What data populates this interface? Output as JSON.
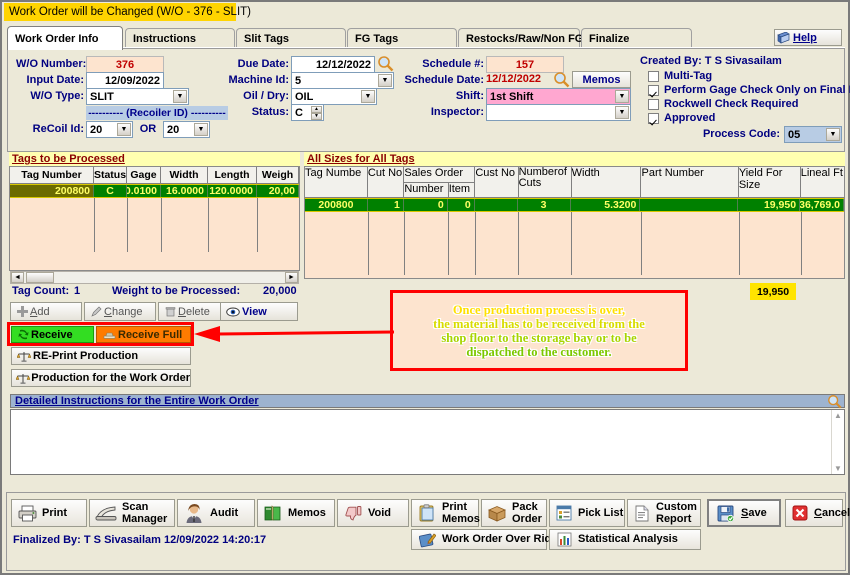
{
  "window": {
    "title": "Work Order will be Changed  (W/O - 376 - SLIT)"
  },
  "tabs": [
    {
      "label": "Work Order Info",
      "active": true
    },
    {
      "label": "Instructions",
      "active": false
    },
    {
      "label": "Slit Tags",
      "active": false
    },
    {
      "label": "FG Tags",
      "active": false
    },
    {
      "label": "Restocks/Raw/Non FG",
      "active": false
    },
    {
      "label": "Finalize",
      "active": false
    }
  ],
  "help_button": "Help",
  "form": {
    "wo_number_label": "W/O Number:",
    "wo_number_value": "376",
    "input_date_label": "Input Date:",
    "input_date_value": "12/09/2022",
    "wo_type_label": "W/O Type:",
    "wo_type_value": "SLIT",
    "recoiler_bar": "---------- (Recoiler ID)  ----------",
    "recoil_id_label": "ReCoil Id:",
    "recoil_id_value": "20",
    "or_label": "OR",
    "recoil_id2_value": "20",
    "due_date_label": "Due Date:",
    "due_date_value": "12/12/2022",
    "machine_id_label": "Machine Id:",
    "machine_id_value": "5",
    "oil_dry_label": "Oil / Dry:",
    "oil_dry_value": "OIL",
    "status_label": "Status:",
    "status_value": "C",
    "schedule_num_label": "Schedule #:",
    "schedule_num_value": "157",
    "schedule_date_label": "Schedule Date:",
    "schedule_date_value": "12/12/2022",
    "memos_button": "Memos",
    "shift_label": "Shift:",
    "shift_value": "1st Shift",
    "inspector_label": "Inspector:",
    "inspector_value": "",
    "created_by": "Created By: T S Sivasailam",
    "checkboxes": [
      {
        "label": "Multi-Tag",
        "checked": false
      },
      {
        "label": "Perform Gage Check Only on Final Break",
        "checked": true
      },
      {
        "label": "Rockwell Check Required",
        "checked": false
      },
      {
        "label": "Approved",
        "checked": true
      }
    ],
    "process_code_label": "Process Code:",
    "process_code_value": "05"
  },
  "left_grid": {
    "title": "Tags to be Processed",
    "columns": [
      "Tag Number",
      "Status",
      "Gage",
      "Width",
      "Length",
      "Weigh"
    ],
    "rows": [
      [
        "200800",
        "C",
        "0.0100",
        "16.0000",
        "120.0000",
        "20,00"
      ]
    ],
    "tag_count_label": "Tag Count:",
    "tag_count_value": "1",
    "weight_label": "Weight to be Processed:",
    "weight_value": "20,000"
  },
  "right_grid": {
    "title": "All Sizes for All Tags",
    "columns": [
      "Tag Numbe",
      "Cut No",
      "Sales Order",
      "Number",
      "Item",
      "Cust No",
      "Number of Cuts",
      "Width",
      "Part Number",
      "Yield For Size",
      "Lineal Ft"
    ],
    "group_header": "Sales Order",
    "sub_headers": [
      "Number",
      "Item"
    ],
    "rows": [
      {
        "tag_number": "200800",
        "cut_no": "1",
        "so_number": "0",
        "so_item": "0",
        "cust_no": "",
        "number_of_cuts": "3",
        "width": "5.3200",
        "part_number": "",
        "yield_for_size": "19,950",
        "lineal_ft": "36,769.0"
      }
    ],
    "total_yield": "19,950"
  },
  "action_buttons": [
    {
      "label": "Add",
      "icon": "plus-icon"
    },
    {
      "label": "Change",
      "icon": "pencil-icon"
    },
    {
      "label": "Delete",
      "icon": "trash-icon"
    },
    {
      "label": "View",
      "icon": "eye-icon"
    }
  ],
  "receive_buttons": [
    {
      "label": "Receive",
      "icon": "receive-icon",
      "color": "#33dd22"
    },
    {
      "label": "Receive Full",
      "icon": "receive-full-icon",
      "color": "#ff7b00"
    }
  ],
  "production_buttons": [
    {
      "label": "RE-Print Production",
      "icon": "scales-icon"
    },
    {
      "label": "Production for the Work Order",
      "icon": "scales-icon"
    }
  ],
  "annotation": {
    "lines": [
      "Once production process is over,",
      "the material has to be received from the",
      "shop floor to the storage bay or to be",
      "dispatched to the customer."
    ],
    "border_color": "#ff0000"
  },
  "instructions": {
    "header": "Detailed Instructions for the Entire Work Order",
    "body": ""
  },
  "toolbar_row1": [
    {
      "label": "Print",
      "icon": "printer-icon"
    },
    {
      "label": "Scan Manager",
      "icon": "scanner-icon",
      "two_line": true,
      "l1": "Scan",
      "l2": "Manager"
    },
    {
      "label": "Audit",
      "icon": "person-icon"
    },
    {
      "label": "Memos",
      "icon": "book-icon"
    },
    {
      "label": "Void",
      "icon": "thumbsdown-icon"
    },
    {
      "label": "Print Memos",
      "icon": "clipboard-icon",
      "two_line": true,
      "l1": "Print",
      "l2": "Memos"
    },
    {
      "label": "Pack Order",
      "icon": "box-icon",
      "two_line": true,
      "l1": "Pack",
      "l2": "Order"
    },
    {
      "label": "Pick List",
      "icon": "list-icon"
    },
    {
      "label": "Custom Report",
      "icon": "report-icon",
      "two_line": true,
      "l1": "Custom",
      "l2": "Report"
    },
    {
      "label": "Save",
      "icon": "save-icon"
    },
    {
      "label": "Cancel",
      "icon": "cancel-icon"
    }
  ],
  "toolbar_row2": [
    {
      "label": "Work Order Over Rides",
      "icon": "overrides-icon"
    },
    {
      "label": "Statistical Analysis",
      "icon": "chart-icon"
    }
  ],
  "footer": {
    "finalized_by": "Finalized By: T S Sivasailam 12/09/2022 14:20:17"
  }
}
